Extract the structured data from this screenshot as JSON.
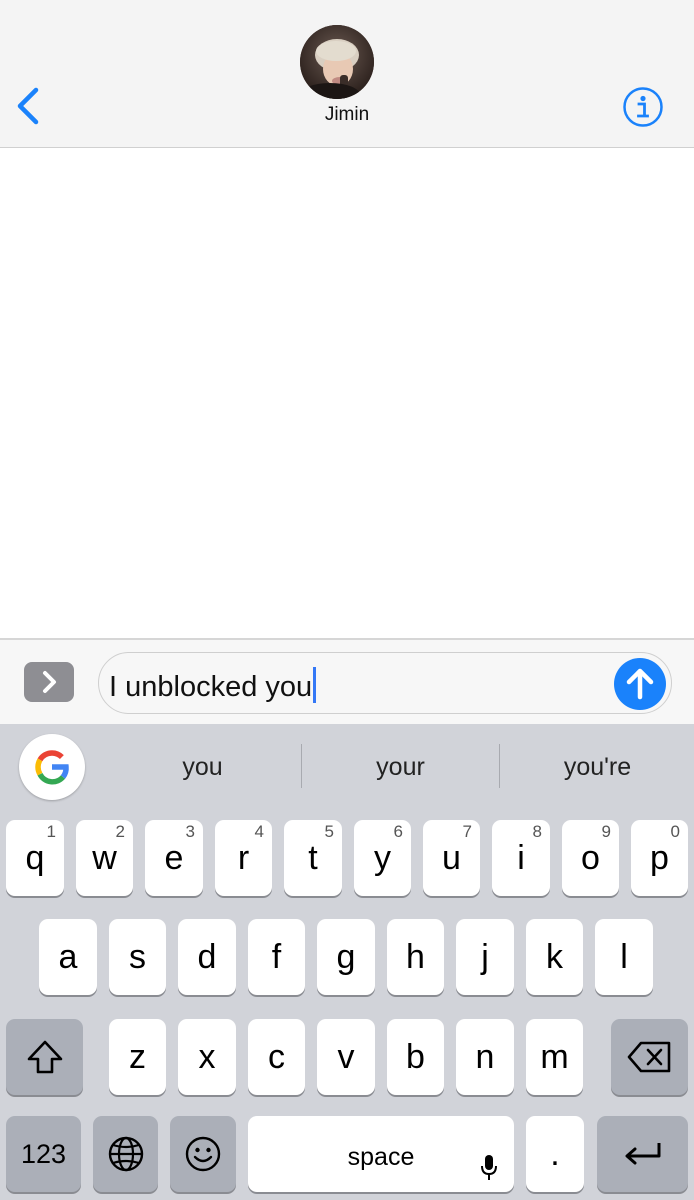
{
  "header": {
    "contact_name": "Jimin",
    "back_icon": "chevron-left-icon",
    "info_icon": "info-icon",
    "accent_color": "#1a82fb"
  },
  "compose": {
    "apps_icon": "chevron-right-icon",
    "message_text": "I unblocked you",
    "send_icon": "arrow-up-icon"
  },
  "keyboard": {
    "suggestions": [
      "you",
      "your",
      "you're"
    ],
    "row1": [
      {
        "letter": "q",
        "num": "1"
      },
      {
        "letter": "w",
        "num": "2"
      },
      {
        "letter": "e",
        "num": "3"
      },
      {
        "letter": "r",
        "num": "4"
      },
      {
        "letter": "t",
        "num": "5"
      },
      {
        "letter": "y",
        "num": "6"
      },
      {
        "letter": "u",
        "num": "7"
      },
      {
        "letter": "i",
        "num": "8"
      },
      {
        "letter": "o",
        "num": "9"
      },
      {
        "letter": "p",
        "num": "0"
      }
    ],
    "row2": [
      "a",
      "s",
      "d",
      "f",
      "g",
      "h",
      "j",
      "k",
      "l"
    ],
    "row3": [
      "z",
      "x",
      "c",
      "v",
      "b",
      "n",
      "m"
    ],
    "numbers_label": "123",
    "space_label": "space",
    "period_label": "."
  }
}
